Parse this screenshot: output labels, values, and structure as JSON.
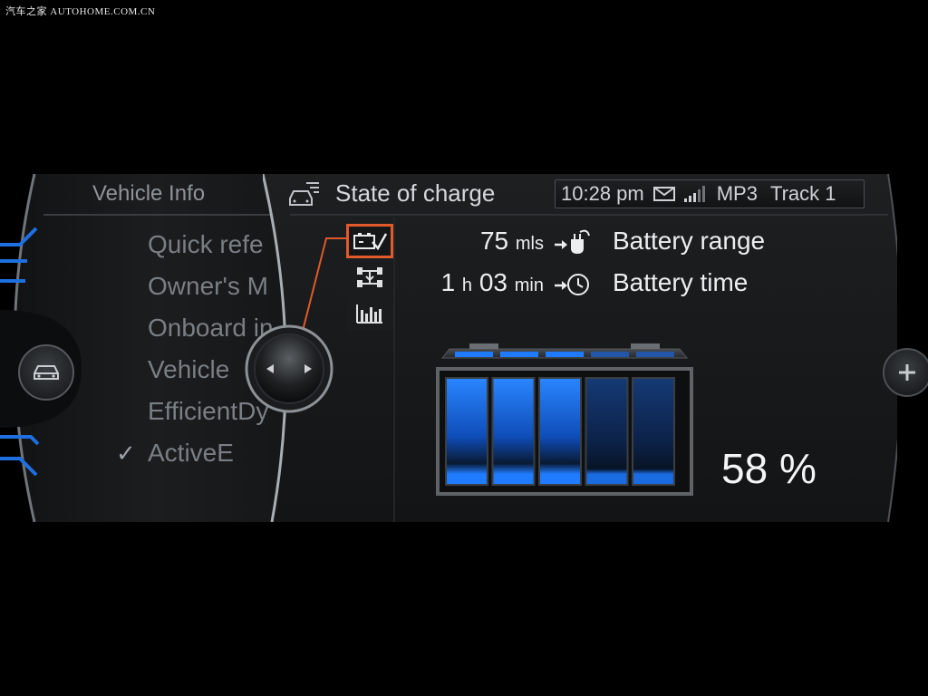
{
  "watermark": "汽车之家 AUTOHOME.COM.CN",
  "left_menu": {
    "title": "Vehicle Info",
    "items": [
      {
        "label": "Quick refe",
        "checked": false
      },
      {
        "label": "Owner's M",
        "checked": false
      },
      {
        "label": "Onboard in",
        "checked": false
      },
      {
        "label": "Vehicle",
        "checked": false
      },
      {
        "label": "EfficientDy",
        "checked": false
      },
      {
        "label": "ActiveE",
        "checked": true
      }
    ],
    "check_mark": "✓",
    "car_button_icon": "car-icon"
  },
  "header": {
    "title": "State of charge",
    "icon": "car-menu-icon",
    "status": {
      "time": "10:28 pm",
      "message_icon": "envelope-icon",
      "signal_icon": "signal-bars-icon",
      "source": "MP3",
      "track": "Track 1"
    }
  },
  "side_tabs": [
    {
      "icon": "battery-check-icon",
      "active": true
    },
    {
      "icon": "drivetrain-icon",
      "active": false
    },
    {
      "icon": "bar-chart-icon",
      "active": false
    }
  ],
  "battery_range": {
    "value": "75",
    "unit": "mls",
    "label": "Battery range",
    "icon": "charge-plug-icon"
  },
  "battery_time": {
    "hours": "1",
    "hours_unit": "h",
    "minutes": "03",
    "minutes_unit": "min",
    "label": "Battery time",
    "icon": "charge-clock-icon"
  },
  "charge": {
    "percent": 58,
    "percent_text": "58 %",
    "segments_total": 5,
    "segments_lit": 3,
    "accent_color": "#1e7bff",
    "dim_color": "#0d2a55"
  },
  "colors": {
    "active_tab_border": "#e05a2b",
    "pointer_line": "#e05a2b"
  }
}
